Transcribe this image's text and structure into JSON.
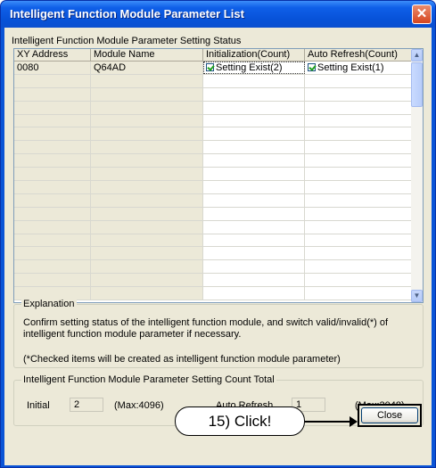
{
  "window": {
    "title": "Intelligent Function Module Parameter List",
    "close_glyph": "✕"
  },
  "status_caption": "Intelligent Function Module Parameter Setting Status",
  "table": {
    "headers": [
      "XY Address",
      "Module Name",
      "Initialization(Count)",
      "Auto Refresh(Count)"
    ],
    "rows": [
      {
        "xy_address": "0080",
        "module_name": "Q64AD",
        "initialization": "Setting Exist(2)",
        "auto_refresh": "Setting Exist(1)",
        "initialization_checked": true,
        "auto_refresh_checked": true
      }
    ],
    "empty_row_count": 17
  },
  "explanation": {
    "title": "Explanation",
    "line1": "Confirm setting status of the intelligent function module, and switch valid/invalid(*) of",
    "line2": "intelligent function module parameter if necessary.",
    "note": "(*Checked items will be created as intelligent function module parameter)"
  },
  "count_total": {
    "title": "Intelligent Function Module Parameter Setting Count Total",
    "initial_label": "Initial",
    "initial_value": "2",
    "initial_max": "(Max:4096)",
    "auto_refresh_label": "Auto Refresh",
    "auto_refresh_value": "1",
    "auto_refresh_max": "(Max:2048)"
  },
  "buttons": {
    "close_label": "Close"
  },
  "annotation": {
    "callout_text": "15) Click!"
  },
  "scrollbar": {
    "up_glyph": "▲",
    "down_glyph": "▼"
  }
}
